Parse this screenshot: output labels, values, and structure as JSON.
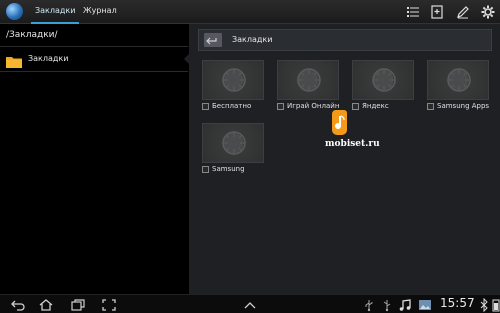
{
  "topbar": {
    "tabs": [
      {
        "label": "Закладки",
        "active": true
      },
      {
        "label": "Журнал",
        "active": false
      }
    ],
    "actions": [
      "list-icon",
      "add-bookmark-icon",
      "edit-icon",
      "settings-icon"
    ]
  },
  "left": {
    "path": "/Закладки/",
    "folders": [
      {
        "label": "Закладки",
        "icon": "folder-icon"
      }
    ]
  },
  "right": {
    "title": "Закладки",
    "bookmarks": [
      {
        "label": "Бесплатно"
      },
      {
        "label": "Играй Онлайн"
      },
      {
        "label": "Яндекс"
      },
      {
        "label": "Samsung Apps"
      },
      {
        "label": "Samsung"
      }
    ]
  },
  "watermark": {
    "text": "mobiset.ru"
  },
  "statusbar": {
    "time": "15:57",
    "nav": [
      "back-icon",
      "home-icon",
      "recent-apps-icon",
      "screenshot-icon",
      "up-arrow-icon"
    ],
    "notifications": [
      "usb-icon",
      "usb-debug-icon",
      "music-icon",
      "image-icon",
      "bluetooth-icon"
    ]
  },
  "colors": {
    "accent": "#3aa1d8",
    "folder": "#f2a51a",
    "watermark": "#f39a18"
  }
}
